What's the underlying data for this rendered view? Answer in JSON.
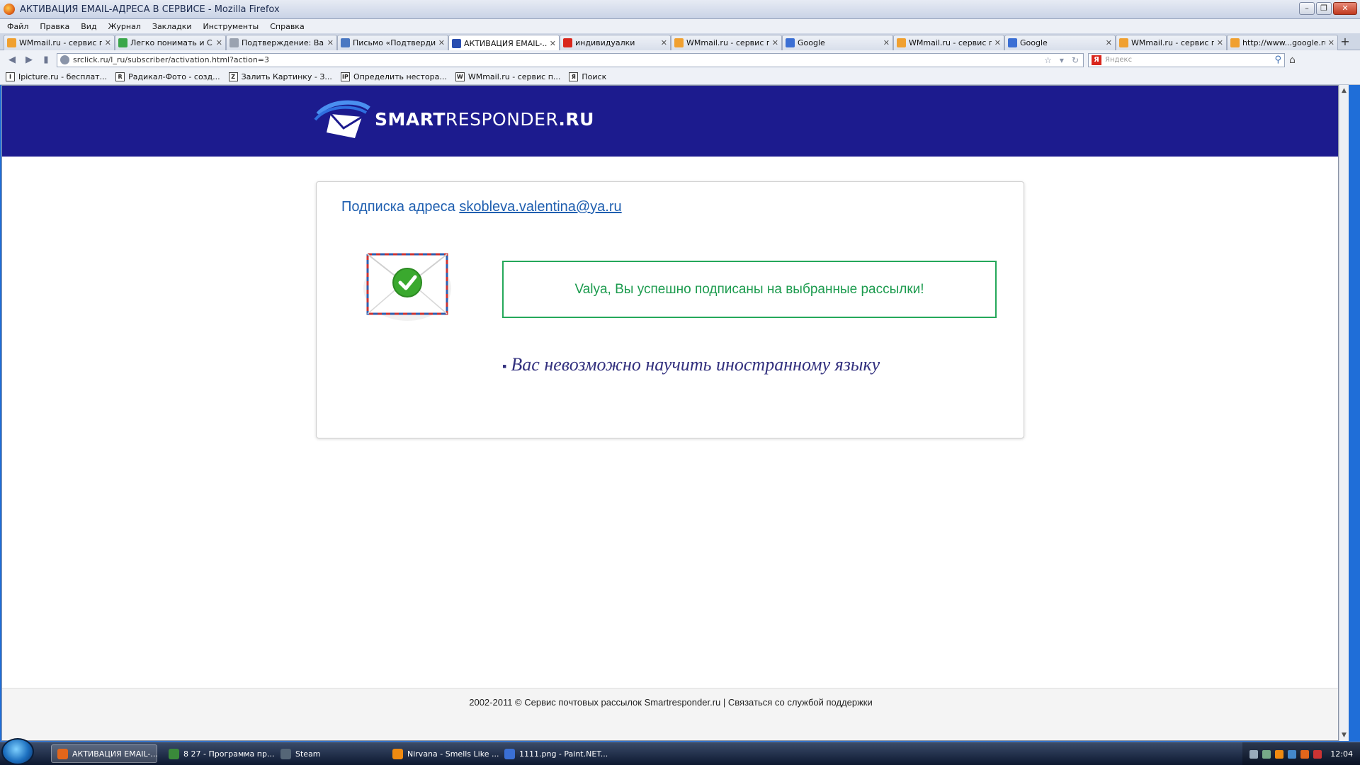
{
  "window": {
    "title": "АКТИВАЦИЯ EMAIL-АДРЕСА В СЕРВИСЕ - Mozilla Firefox"
  },
  "menu": [
    "Файл",
    "Правка",
    "Вид",
    "Журнал",
    "Закладки",
    "Инструменты",
    "Справка"
  ],
  "tabs": [
    {
      "label": "WMmail.ru - сервис п...",
      "icon": "wmmail-icon",
      "color": "#f0a030",
      "active": false
    },
    {
      "label": "Легко понимать и С...",
      "icon": "loading-icon",
      "color": "#3aa64a",
      "active": false
    },
    {
      "label": "Подтверждение: Ва...",
      "icon": "page-icon",
      "color": "#9aa2b0",
      "active": false
    },
    {
      "label": "Письмо «Подтверди...",
      "icon": "mail-icon",
      "color": "#4a78c2",
      "active": false
    },
    {
      "label": "АКТИВАЦИЯ EMAIL-...",
      "icon": "sr-icon",
      "color": "#2b4fb0",
      "active": true
    },
    {
      "label": "индивидуалки",
      "icon": "d-icon",
      "color": "#d9261c",
      "active": false
    },
    {
      "label": "WMmail.ru - сервис п...",
      "icon": "wmmail-icon",
      "color": "#f0a030",
      "active": false
    },
    {
      "label": "Google",
      "icon": "google-icon",
      "color": "#3b6fd4",
      "active": false
    },
    {
      "label": "WMmail.ru - сервис п...",
      "icon": "wmmail-icon",
      "color": "#f0a030",
      "active": false
    },
    {
      "label": "Google",
      "icon": "google-icon",
      "color": "#3b6fd4",
      "active": false
    },
    {
      "label": "WMmail.ru - сервис п...",
      "icon": "wmmail-icon",
      "color": "#f0a030",
      "active": false
    },
    {
      "label": "http://www...google.ru",
      "icon": "wmmail-icon",
      "color": "#f0a030",
      "active": false
    }
  ],
  "nav": {
    "url": "srclick.ru/l_ru/subscriber/activation.html?action=3",
    "search_placeholder": "Яндекс",
    "search_engine_label": "Я"
  },
  "bookmarks": [
    {
      "label": "Ipicture.ru - бесплат...",
      "icon_text": "I"
    },
    {
      "label": "Радикал-Фото - созд...",
      "icon_text": "R"
    },
    {
      "label": "Залить Картинку - З...",
      "icon_text": "Z"
    },
    {
      "label": "Определить нестора...",
      "icon_text": "IP"
    },
    {
      "label": "WMmail.ru - сервис п...",
      "icon_text": "W"
    },
    {
      "label": "Поиск",
      "icon_text": "Я"
    }
  ],
  "page": {
    "logo_bold": "SMART",
    "logo_thin": "RESPONDER",
    "logo_suffix": ".RU",
    "subscription_prefix": "Подписка адреса",
    "email": "skobleva.valentina@ya.ru",
    "success_message": "Valya, Вы успешно подписаны на выбранные рассылки!",
    "quote": "Вас невозможно научить иностранному языку",
    "quote_bullet": "▪",
    "footer_copyright": "2002-2011 © Сервис почтовых рассылок Smartresponder.ru",
    "footer_separator": "|",
    "footer_support": "Связаться со службой поддержки",
    "colors": {
      "header": "#1c1b8e",
      "success": "#1c9b4e",
      "link": "#1f5fb0",
      "quote": "#32307e"
    }
  },
  "taskbar": {
    "tasks": [
      {
        "label": "АКТИВАЦИЯ EMAIL-...",
        "color": "#e2661b",
        "active": true
      },
      {
        "label": "8 27 - Программа пр...",
        "color": "#3a8a3a",
        "active": false
      },
      {
        "label": "Steam",
        "color": "#556677",
        "active": false
      },
      {
        "label": "Nirvana - Smells Like ...",
        "color": "#f08a10",
        "active": false
      },
      {
        "label": "1111.png - Paint.NET...",
        "color": "#3a6fd4",
        "active": false
      }
    ],
    "clock": "12:04"
  }
}
